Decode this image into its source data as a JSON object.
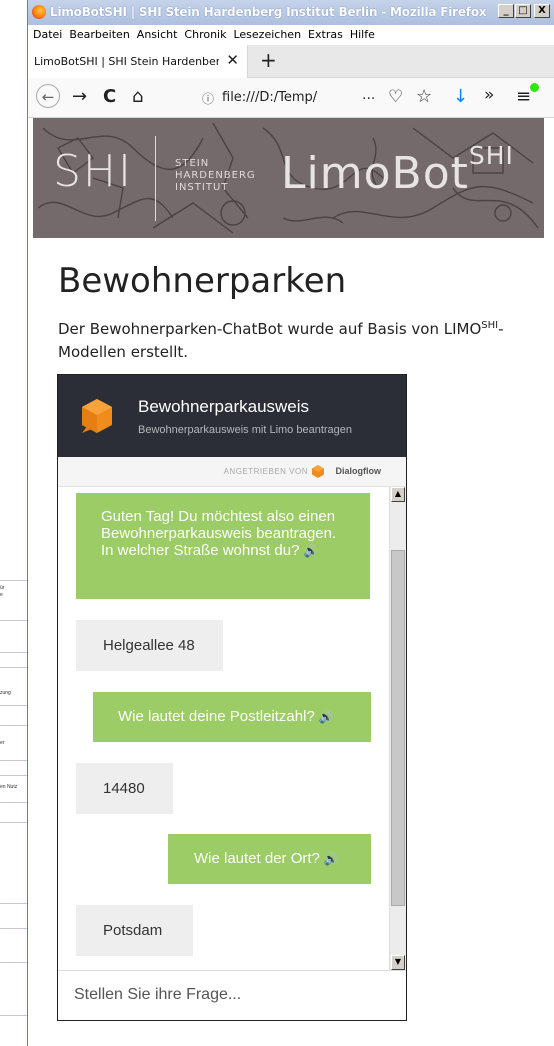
{
  "background_doc": {
    "snippets": [
      "ür",
      "e",
      "zung",
      "er",
      "en Nutz"
    ]
  },
  "window": {
    "title": "LimoBotSHI | SHI Stein Hardenberg Institut Berlin - Mozilla Firefox",
    "buttons": {
      "minimize": "_",
      "maximize": "□",
      "close": "X"
    }
  },
  "menubar": {
    "items": [
      "Datei",
      "Bearbeiten",
      "Ansicht",
      "Chronik",
      "Lesezeichen",
      "Extras",
      "Hilfe"
    ]
  },
  "tabs": {
    "active_label": "LimoBotSHI | SHI Stein Hardenberg Institut",
    "close": "✕",
    "new_tab": "+"
  },
  "navbar": {
    "back": "←",
    "forward": "→",
    "reload": "C",
    "home": "⌂",
    "info": "ⓘ",
    "url": "file:///D:/Temp/",
    "more": "···",
    "pocket": "♡",
    "star": "☆",
    "download": "↓",
    "overflow": "»",
    "menu": "≡"
  },
  "banner": {
    "shi": "SHI",
    "institute_lines": [
      "STEIN",
      "HARDENBERG",
      "INSTITUT"
    ],
    "limobot": "LimoBot",
    "limobot_sup": "SHI"
  },
  "page": {
    "heading": "Bewohnerparken",
    "desc_before": "Der Bewohnerparken-ChatBot wurde auf Basis von LIMO",
    "desc_sup": "SHI",
    "desc_after": "-Modellen erstellt."
  },
  "chat": {
    "title": "Bewohnerparkausweis",
    "subtitle": "Bewohnerparkausweis mit Limo beantragen",
    "powered_by": "ANGETRIEBEN VON",
    "powered_name": "Dialogflow",
    "speaker_icon": "🔊",
    "input_placeholder": "Stellen Sie ihre Frage...",
    "messages": [
      {
        "role": "bot",
        "text": "Guten Tag! Du möchtest also einen Bewohnerparkausweis beantragen. In welcher Straße wohnst du?"
      },
      {
        "role": "user",
        "text": "Helgeallee 48"
      },
      {
        "role": "bot",
        "text": "Wie lautet deine Postleitzahl?"
      },
      {
        "role": "user",
        "text": "14480"
      },
      {
        "role": "bot",
        "text": "Wie lautet der Ort?"
      },
      {
        "role": "user",
        "text": "Potsdam"
      }
    ],
    "colors": {
      "header": "#2b2e36",
      "bot_bubble": "#9ccc65",
      "user_bubble": "#eeeeee"
    }
  }
}
